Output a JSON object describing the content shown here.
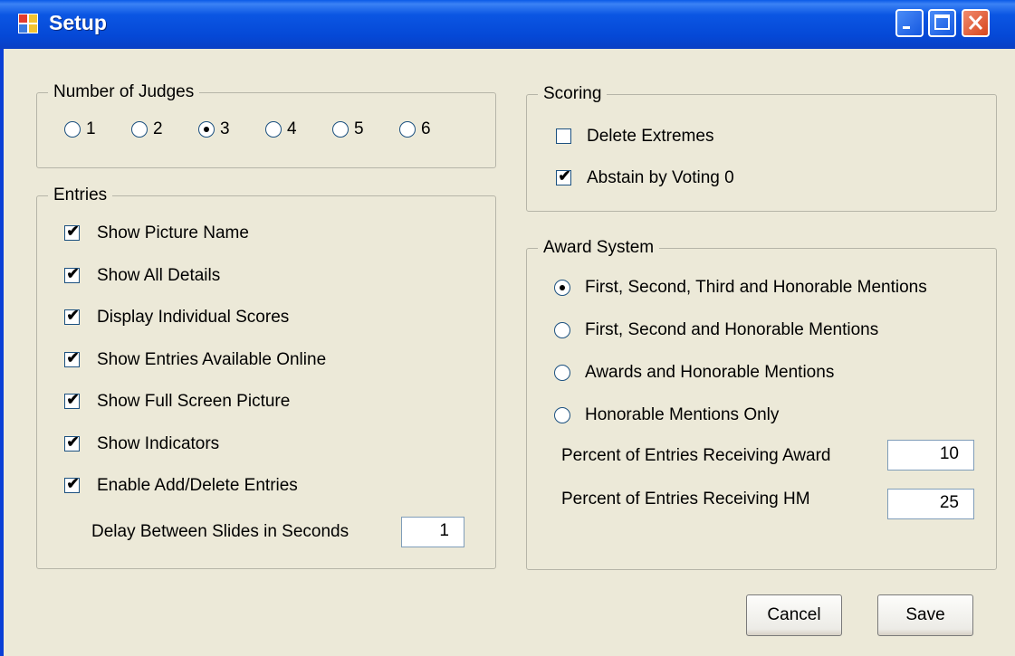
{
  "window": {
    "title": "Setup"
  },
  "judges": {
    "legend": "Number of Judges",
    "options": [
      "1",
      "2",
      "3",
      "4",
      "5",
      "6"
    ],
    "selected": "3"
  },
  "entries": {
    "legend": "Entries",
    "options": [
      {
        "label": "Show Picture Name",
        "checked": true
      },
      {
        "label": "Show All Details",
        "checked": true
      },
      {
        "label": "Display Individual Scores",
        "checked": true
      },
      {
        "label": "Show Entries Available Online",
        "checked": true
      },
      {
        "label": "Show Full Screen Picture",
        "checked": true
      },
      {
        "label": "Show Indicators",
        "checked": true
      },
      {
        "label": "Enable Add/Delete Entries",
        "checked": true
      }
    ],
    "delay_label": "Delay Between Slides in Seconds",
    "delay_value": "1"
  },
  "scoring": {
    "legend": "Scoring",
    "options": [
      {
        "label": "Delete Extremes",
        "checked": false
      },
      {
        "label": "Abstain by Voting 0",
        "checked": true
      }
    ]
  },
  "award": {
    "legend": "Award System",
    "options": [
      {
        "label": "First, Second, Third and Honorable Mentions",
        "selected": true
      },
      {
        "label": "First, Second and Honorable Mentions",
        "selected": false
      },
      {
        "label": "Awards and Honorable Mentions",
        "selected": false
      },
      {
        "label": "Honorable Mentions Only",
        "selected": false
      }
    ],
    "percent_award_label": "Percent of Entries Receiving Award",
    "percent_award_value": "10",
    "percent_hm_label": "Percent of Entries Receiving HM",
    "percent_hm_value": "25"
  },
  "buttons": {
    "cancel": "Cancel",
    "save": "Save"
  }
}
